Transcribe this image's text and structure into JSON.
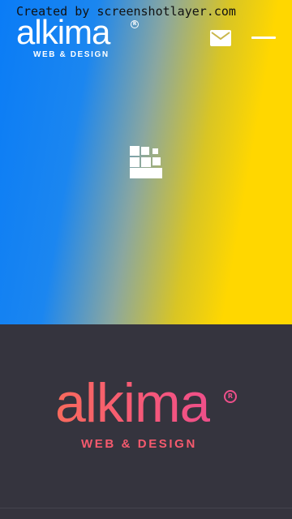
{
  "watermark": "Created by screenshotlayer.com",
  "header": {
    "logo": {
      "wordmark": "alkima",
      "registered": "R",
      "tagline": "WEB & DESIGN"
    },
    "mail_icon": "envelope-icon",
    "menu_icon": "hamburger-menu-icon"
  },
  "hero": {
    "gradient_start": "#0a7cf6",
    "gradient_end": "#ffd700",
    "center_icon": "pixel-blocks-icon"
  },
  "footer": {
    "logo": {
      "wordmark": "alkima",
      "registered": "R",
      "tagline": "WEB & DESIGN"
    },
    "background": "#35343e",
    "accent": "#f6587a"
  }
}
